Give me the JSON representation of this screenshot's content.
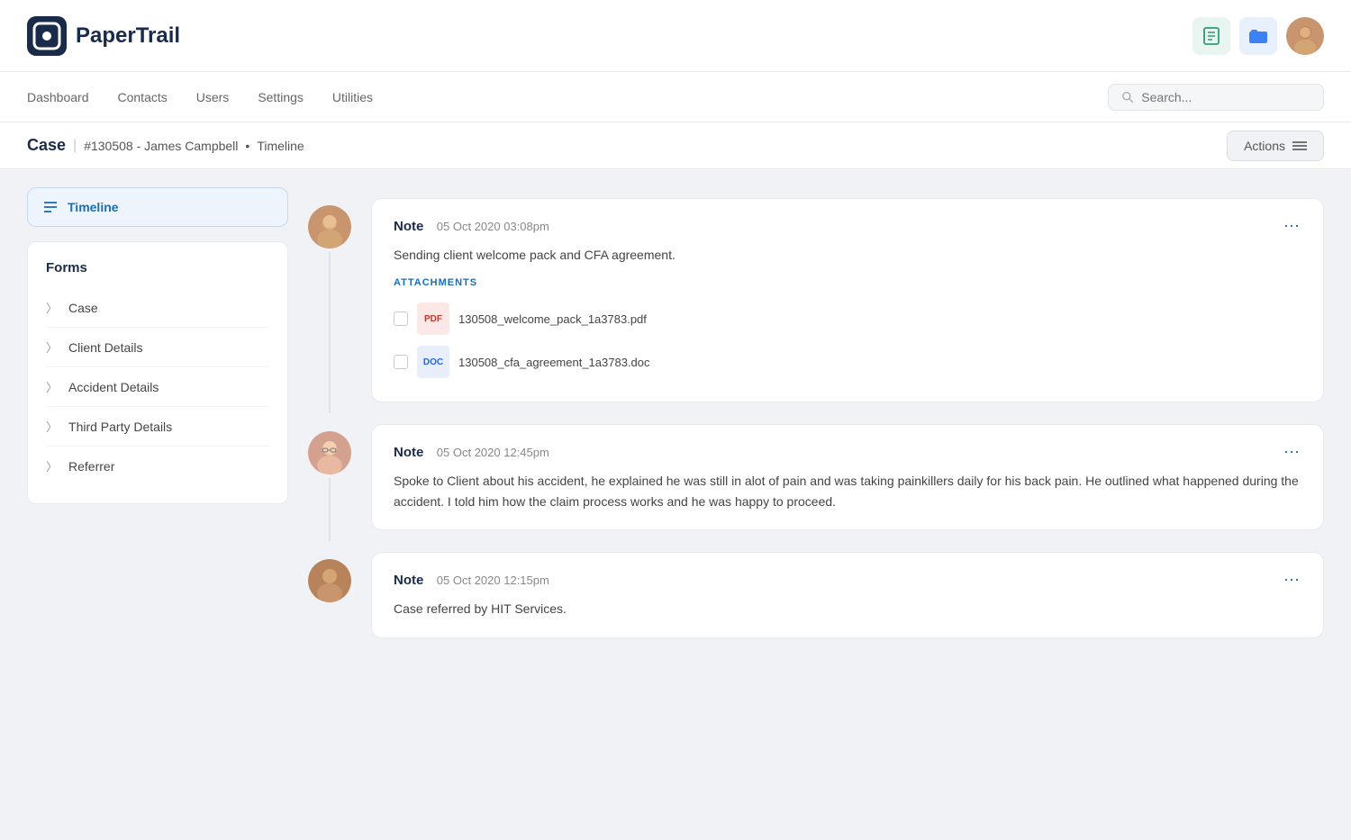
{
  "app": {
    "name": "PaperTrail"
  },
  "nav": {
    "links": [
      "Dashboard",
      "Contacts",
      "Users",
      "Settings",
      "Utilities"
    ]
  },
  "search": {
    "placeholder": "Search..."
  },
  "breadcrumb": {
    "case_label": "Case",
    "separator": "|",
    "case_id": "#130508 - James Campbell",
    "dot": "•",
    "section": "Timeline"
  },
  "actions_button": "Actions",
  "sidebar": {
    "timeline_label": "Timeline",
    "forms_title": "Forms",
    "items": [
      {
        "label": "Case"
      },
      {
        "label": "Client Details"
      },
      {
        "label": "Accident Details"
      },
      {
        "label": "Third Party Details"
      },
      {
        "label": "Referrer"
      }
    ]
  },
  "timeline": {
    "notes": [
      {
        "id": 1,
        "title": "Note",
        "date": "05 Oct 2020 03:08pm",
        "body": "Sending client welcome pack and CFA agreement.",
        "avatar_type": "male1",
        "has_attachments": true,
        "attachments_label": "ATTACHMENTS",
        "attachments": [
          {
            "type": "pdf",
            "name": "130508_welcome_pack_1a3783.pdf",
            "icon_label": "PDF"
          },
          {
            "type": "doc",
            "name": "130508_cfa_agreement_1a3783.doc",
            "icon_label": "DOC"
          }
        ]
      },
      {
        "id": 2,
        "title": "Note",
        "date": "05 Oct 2020 12:45pm",
        "body": "Spoke to Client about his accident, he explained he was still in alot of pain and was taking painkillers daily for his back pain. He outlined what happened during the accident. I told him how the claim process works and he was happy to proceed.",
        "avatar_type": "female1",
        "has_attachments": false,
        "attachments": []
      },
      {
        "id": 3,
        "title": "Note",
        "date": "05 Oct 2020 12:15pm",
        "body": "Case referred by HIT Services.",
        "avatar_type": "male2",
        "has_attachments": false,
        "attachments": []
      }
    ]
  },
  "colors": {
    "accent": "#1a6eb5",
    "bg": "#f0f2f5"
  }
}
